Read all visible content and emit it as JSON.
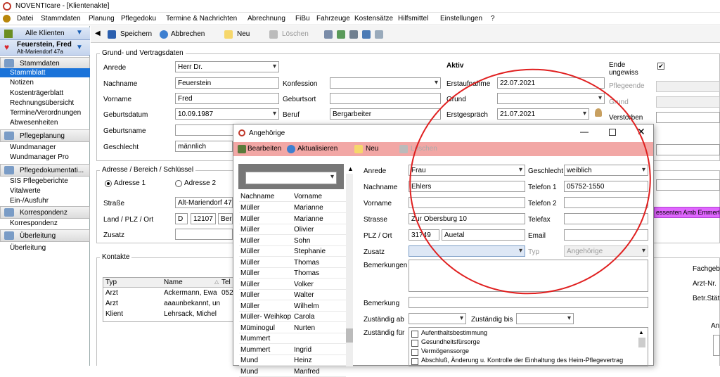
{
  "window": {
    "title": "NOVENTIcare - [Klientenakte]"
  },
  "menu": [
    "Datei",
    "Stammdaten",
    "Planung",
    "Pflegedoku",
    "Termine & Nachrichten",
    "Abrechnung",
    "FiBu",
    "Fahrzeuge",
    "Kostensätze",
    "Hilfsmittel",
    "Einstellungen",
    "?"
  ],
  "sidebar": {
    "all_clients": "Alle Klienten",
    "client_name": "Feuerstein, Fred",
    "client_address": "Alt-Mariendorf 47a",
    "sections": [
      {
        "label": "Stammdaten",
        "items": [
          "Stammblatt",
          "Notizen",
          "Kostenträgerblatt",
          "Rechnungsübersicht",
          "Termine/Verordnungen",
          "Abwesenheiten"
        ]
      },
      {
        "label": "Pflegeplanung",
        "items": [
          "Wundmanager",
          "Wundmanager Pro"
        ]
      },
      {
        "label": "Pflegedokumentati...",
        "items": [
          "SIS Pflegeberichte",
          "Vitalwerte",
          "Ein-/Ausfuhr"
        ]
      },
      {
        "label": "Korrespondenz",
        "items": [
          "Korrespondenz"
        ]
      },
      {
        "label": "Überleitung",
        "items": [
          "Überleitung"
        ]
      }
    ],
    "selected": "Stammblatt"
  },
  "toolbar": {
    "save": "Speichern",
    "cancel": "Abbrechen",
    "new": "Neu",
    "delete": "Löschen"
  },
  "grunddaten": {
    "title": "Grund- und Vertragsdaten",
    "anrede_label": "Anrede",
    "anrede": "Herr Dr.",
    "nachname_label": "Nachname",
    "nachname": "Feuerstein",
    "vorname_label": "Vorname",
    "vorname": "Fred",
    "geburtsdatum_label": "Geburtsdatum",
    "geburtsdatum": "10.09.1987",
    "geburtsname_label": "Geburtsname",
    "geschlecht_label": "Geschlecht",
    "geschlecht": "männlich",
    "konfession_label": "Konfession",
    "geburtsort_label": "Geburtsort",
    "beruf_label": "Beruf",
    "beruf": "Bergarbeiter",
    "status": "Aktiv",
    "erstaufnahme_label": "Erstaufnahme",
    "erstaufnahme": "22.07.2021",
    "grund_label": "Grund",
    "erstgespraech_label": "Erstgespräch",
    "erstgespraech": "21.07.2021",
    "ende_label": "Ende ungewiss",
    "ende_check": "✔",
    "pflegeende_label": "Pflegeende",
    "grund2_label": "Grund",
    "verstorben_label": "Verstorben"
  },
  "adresse": {
    "title": "Adresse / Bereich / Schlüssel",
    "adresse1": "Adresse 1",
    "adresse2": "Adresse 2",
    "strasse_label": "Straße",
    "strasse": "Alt-Mariendorf 47a",
    "land_label": "Land / PLZ / Ort",
    "land": "D",
    "plz": "12107",
    "ort": "Berlin",
    "zusatz_label": "Zusatz",
    "tag": "essenten Amb Emmerti"
  },
  "kontakte": {
    "title": "Kontakte",
    "headers": [
      "Typ",
      "Name",
      "Tel"
    ],
    "rows": [
      [
        "Arzt",
        "Ackermann, Ewa",
        "052"
      ],
      [
        "Arzt",
        "aaaunbekannt, un",
        ""
      ],
      [
        "Klient",
        "Lehrsack, Michel",
        ""
      ]
    ]
  },
  "right_labels": {
    "fachgeb": "Fachgeb",
    "arzt_nr": "Arzt-Nr.",
    "betr": "Betr.Stät",
    "an": "An"
  },
  "dialog": {
    "title": "Angehörige",
    "edit": "Bearbeiten",
    "refresh": "Aktualisieren",
    "new": "Neu",
    "delete": "Löschen",
    "list_headers": [
      "Nachname",
      "Vorname"
    ],
    "list": [
      [
        "Müller",
        "Marianne"
      ],
      [
        "Müller",
        "Marianne"
      ],
      [
        "Müller",
        "Olivier"
      ],
      [
        "Müller",
        "Sohn"
      ],
      [
        "Müller",
        "Stephanie"
      ],
      [
        "Müller",
        "Thomas"
      ],
      [
        "Müller",
        "Thomas"
      ],
      [
        "Müller",
        "Volker"
      ],
      [
        "Müller",
        "Walter"
      ],
      [
        "Müller",
        "Wilhelm"
      ],
      [
        "Müller- Weihkop",
        "Carola"
      ],
      [
        "Müminogul",
        "Nurten"
      ],
      [
        "Mummert",
        ""
      ],
      [
        "Mummert",
        "Ingrid"
      ],
      [
        "Mund",
        "Heinz"
      ],
      [
        "Mund",
        "Manfred"
      ]
    ],
    "anrede_label": "Anrede",
    "anrede": "Frau",
    "geschlecht_label": "Geschlecht",
    "geschlecht": "weiblich",
    "nachname_label": "Nachname",
    "nachname": "Ehlers",
    "telefon1_label": "Telefon 1",
    "telefon1": "05752-1550",
    "vorname_label": "Vorname",
    "vorname": ".",
    "telefon2_label": "Telefon 2",
    "strasse_label": "Strasse",
    "strasse": "Zur Obersburg 10",
    "telefax_label": "Telefax",
    "plz_label": "PLZ / Ort",
    "plz": "31749",
    "ort": "Auetal",
    "email_label": "Email",
    "zusatz_label": "Zusatz",
    "typ_label": "Typ",
    "typ": "Angehörige",
    "bemerkungen_label": "Bemerkungen",
    "bemerkung_label": "Bemerkung",
    "zustaendig_ab_label": "Zuständig ab",
    "zustaendig_bis_label": "Zuständig bis",
    "zustaendig_fuer_label": "Zuständig für",
    "zustaendig_items": [
      "Aufenthaltsbestimmung",
      "Gesundheitsfürsorge",
      "Vermögenssorge",
      "Abschluß, Änderung u. Kontrolle der Einhaltung des Heim-Pflegevertrag"
    ]
  },
  "colors": {
    "accent": "#1a73d9",
    "dialog_toolbar": "#f2a7a5",
    "annotation": "#e02020",
    "tag": "#e066ff"
  }
}
